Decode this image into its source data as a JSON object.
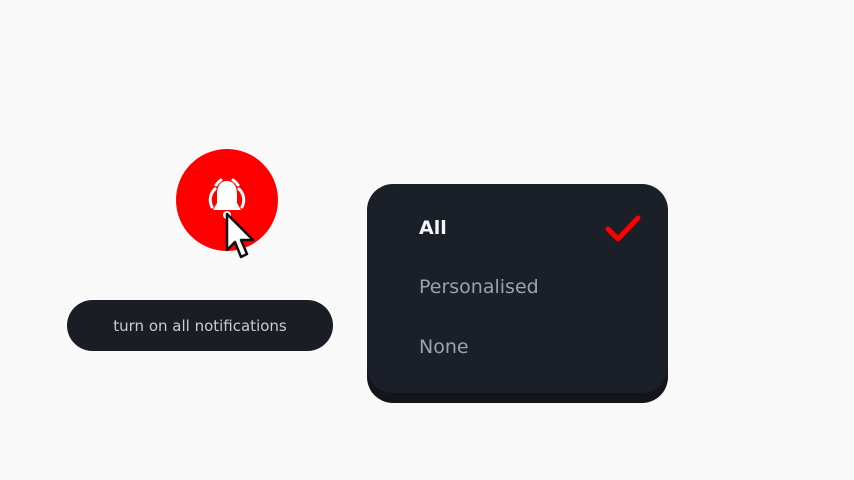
{
  "colors": {
    "accent": "#ff0000",
    "background": "#f9f9f9",
    "panel": "#1b1f27",
    "pill": "#1a1d24"
  },
  "bell": {
    "icon": "ringing-bell-icon"
  },
  "cursor": {
    "icon": "mouse-pointer-icon"
  },
  "notify_button": {
    "label": "turn on all notifications"
  },
  "menu": {
    "selected": "All",
    "check_icon": "checkmark-icon",
    "items": [
      {
        "label": "All"
      },
      {
        "label": "Personalised"
      },
      {
        "label": "None"
      }
    ]
  }
}
